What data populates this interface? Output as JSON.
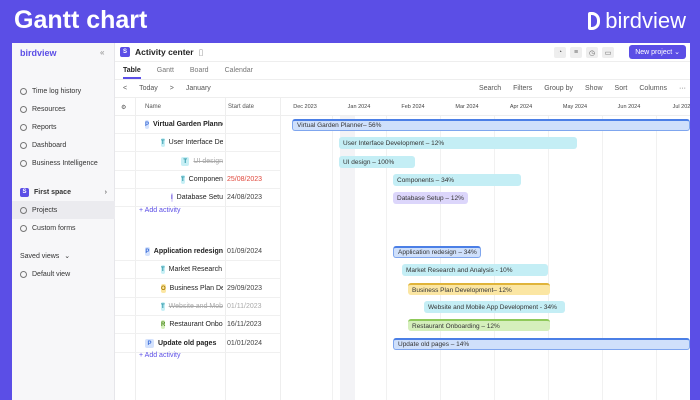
{
  "page_title": "Gantt chart",
  "brand": "birdview",
  "sidebar": {
    "logo": "birdview",
    "collapse": "«",
    "items": [
      {
        "label": "Time log history"
      },
      {
        "label": "Resources"
      },
      {
        "label": "Reports"
      },
      {
        "label": "Dashboard"
      },
      {
        "label": "Business Intelligence"
      }
    ],
    "space": {
      "badge": "S",
      "label": "First space"
    },
    "space_items": [
      {
        "label": "Projects"
      },
      {
        "label": "Custom forms"
      }
    ],
    "saved_views": "Saved views",
    "default_view": "Default view"
  },
  "header": {
    "badge": "S",
    "title": "Activity center",
    "new_project": "New project ⌄"
  },
  "tabs": [
    "Table",
    "Gantt",
    "Board",
    "Calendar"
  ],
  "toolbar": {
    "prev": "<",
    "today": "Today",
    "next": ">",
    "month": "January",
    "search": "Search",
    "filters": "Filters",
    "group_by": "Group by",
    "show": "Show",
    "sort": "Sort",
    "columns": "Columns",
    "more": "···"
  },
  "columns": {
    "name": "Name",
    "start": "Start date"
  },
  "months": [
    "Dec 2023",
    "Jan 2024",
    "Feb 2024",
    "Mar 2024",
    "Apr 2024",
    "May 2024",
    "Jun 2024",
    "Jul 2024"
  ],
  "rows": [
    {
      "badge": "P",
      "name": "Virtual Garden Planner",
      "date": "",
      "bar": "Virtual Garden Planner– 56%"
    },
    {
      "badge": "T",
      "name": "User Interface Development",
      "date": "",
      "bar": "User Interface Development – 12%"
    },
    {
      "badge": "T",
      "name": "UI design",
      "date": "",
      "bar": "UI design – 100%"
    },
    {
      "badge": "T",
      "name": "Components",
      "date": "25/08/2023",
      "bar": "Components – 34%"
    },
    {
      "badge": "I",
      "name": "Database Setup",
      "date": "24/08/2023",
      "bar": "Database Setup – 12%"
    },
    {
      "badge": "P",
      "name": "Application redesign",
      "date": "01/09/2024",
      "bar": "Application redesign – 34%"
    },
    {
      "badge": "T",
      "name": "Market Research and Analysis",
      "date": "",
      "bar": "Market Research and Analysis - 10%"
    },
    {
      "badge": "O",
      "name": "Business Plan Development",
      "date": "29/09/2023",
      "bar": "Business Plan Development– 12%"
    },
    {
      "badge": "T",
      "name": "Website and Mobile App Development",
      "date": "01/11/2023",
      "bar": "Website and Mobile App Development - 34%"
    },
    {
      "badge": "R",
      "name": "Restaurant Onboarding",
      "date": "16/11/2023",
      "bar": "Restaurant Onboarding – 12%"
    },
    {
      "badge": "P",
      "name": "Update old pages",
      "date": "01/01/2024",
      "bar": "Update old pages – 14%"
    }
  ],
  "add_activity": "+ Add activity"
}
